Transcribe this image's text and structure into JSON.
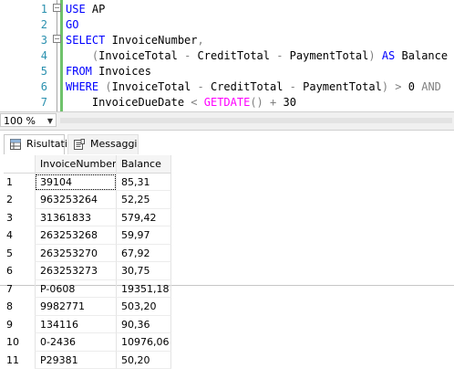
{
  "editor": {
    "lines": [
      {
        "num": "1",
        "parts": [
          {
            "t": "USE",
            "c": "kw"
          },
          {
            "t": " AP",
            "c": ""
          }
        ]
      },
      {
        "num": "2",
        "parts": [
          {
            "t": "GO",
            "c": "kw"
          }
        ]
      },
      {
        "num": "3",
        "parts": [
          {
            "t": "SELECT",
            "c": "kw"
          },
          {
            "t": " InvoiceNumber",
            "c": ""
          },
          {
            "t": ",",
            "c": "op"
          }
        ]
      },
      {
        "num": "4",
        "parts": [
          {
            "t": "    ",
            "c": ""
          },
          {
            "t": "(",
            "c": "op"
          },
          {
            "t": "InvoiceTotal ",
            "c": ""
          },
          {
            "t": "-",
            "c": "op"
          },
          {
            "t": " CreditTotal ",
            "c": ""
          },
          {
            "t": "-",
            "c": "op"
          },
          {
            "t": " PaymentTotal",
            "c": ""
          },
          {
            "t": ")",
            "c": "op"
          },
          {
            "t": " AS",
            "c": "kw"
          },
          {
            "t": " Balance",
            "c": ""
          }
        ]
      },
      {
        "num": "5",
        "parts": [
          {
            "t": "FROM",
            "c": "kw"
          },
          {
            "t": " Invoices",
            "c": ""
          }
        ]
      },
      {
        "num": "6",
        "parts": [
          {
            "t": "WHERE",
            "c": "kw"
          },
          {
            "t": " ",
            "c": ""
          },
          {
            "t": "(",
            "c": "op"
          },
          {
            "t": "InvoiceTotal ",
            "c": ""
          },
          {
            "t": "-",
            "c": "op"
          },
          {
            "t": " CreditTotal ",
            "c": ""
          },
          {
            "t": "-",
            "c": "op"
          },
          {
            "t": " PaymentTotal",
            "c": ""
          },
          {
            "t": ")",
            "c": "op"
          },
          {
            "t": " ",
            "c": ""
          },
          {
            "t": ">",
            "c": "op"
          },
          {
            "t": " 0 ",
            "c": ""
          },
          {
            "t": "AND",
            "c": "op"
          }
        ]
      },
      {
        "num": "7",
        "parts": [
          {
            "t": "    InvoiceDueDate ",
            "c": ""
          },
          {
            "t": "<",
            "c": "op"
          },
          {
            "t": " ",
            "c": ""
          },
          {
            "t": "GETDATE",
            "c": "fn"
          },
          {
            "t": "()",
            "c": "op"
          },
          {
            "t": " ",
            "c": ""
          },
          {
            "t": "+",
            "c": "op"
          },
          {
            "t": " 30",
            "c": ""
          }
        ]
      }
    ]
  },
  "zoom": {
    "value": "100 %"
  },
  "tabs": {
    "results_label": "Risultati",
    "messages_label": "Messaggi"
  },
  "grid": {
    "columns": [
      "InvoiceNumber",
      "Balance"
    ],
    "rows": [
      {
        "n": "1",
        "invoice": "39104",
        "balance": "85,31"
      },
      {
        "n": "2",
        "invoice": "963253264",
        "balance": "52,25"
      },
      {
        "n": "3",
        "invoice": "31361833",
        "balance": "579,42"
      },
      {
        "n": "4",
        "invoice": "263253268",
        "balance": "59,97"
      },
      {
        "n": "5",
        "invoice": "263253270",
        "balance": "67,92"
      },
      {
        "n": "6",
        "invoice": "263253273",
        "balance": "30,75"
      },
      {
        "n": "7",
        "invoice": "P-0608",
        "balance": "19351,18"
      },
      {
        "n": "8",
        "invoice": "9982771",
        "balance": "503,20"
      },
      {
        "n": "9",
        "invoice": "134116",
        "balance": "90,36"
      },
      {
        "n": "10",
        "invoice": "0-2436",
        "balance": "10976,06"
      },
      {
        "n": "11",
        "invoice": "P29381",
        "balance": "50,20"
      }
    ]
  },
  "colors": {
    "keyword": "#0000ff",
    "function": "#ff00ff",
    "operator": "#808080",
    "line_number": "#2b91af"
  }
}
